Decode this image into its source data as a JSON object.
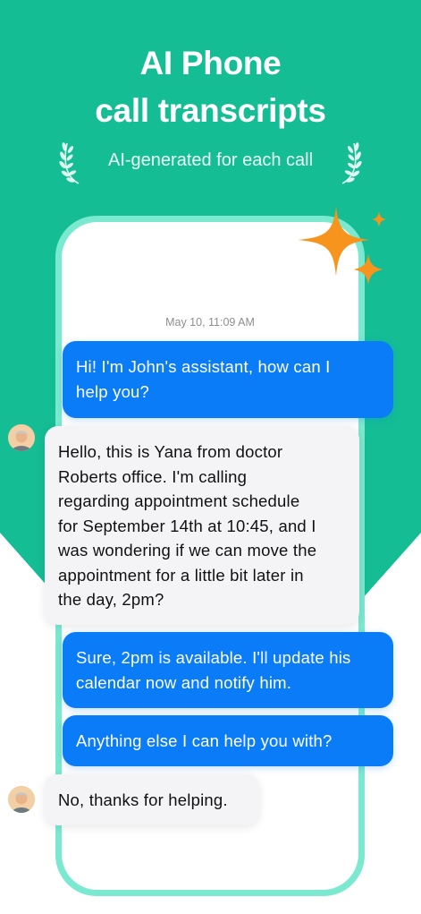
{
  "header": {
    "title_line1": "AI Phone",
    "title_line2": "call transcripts",
    "subtitle": "AI-generated for each call"
  },
  "conversation": {
    "timestamp": "May 10, 11:09 AM",
    "messages": [
      {
        "sender": "assistant",
        "lines": [
          "Hi! I'm John's assistant, how can I",
          "help you?"
        ]
      },
      {
        "sender": "caller",
        "lines": [
          "Hello, this is Yana from doctor",
          "Roberts office. I'm calling",
          "regarding appointment schedule",
          "for September 14th at 10:45, and I",
          "was wondering if we can move the",
          "appointment for a little bit later in",
          "the day, 2pm?"
        ]
      },
      {
        "sender": "assistant",
        "lines": [
          "Sure, 2pm is available. I'll update his",
          "calendar now and notify him."
        ]
      },
      {
        "sender": "assistant",
        "lines": [
          "Anything else I can help you with?"
        ]
      },
      {
        "sender": "caller",
        "lines": [
          "No, thanks for helping."
        ]
      }
    ]
  },
  "colors": {
    "brand_green": "#14bd94",
    "outgoing_bubble": "#0a7cf8",
    "incoming_bubble": "#f4f4f6",
    "sparkle": "#f7941d",
    "phone_frame": "#7ae9cf"
  },
  "icons": {
    "laurel_left": "laurel-left-icon",
    "laurel_right": "laurel-right-icon",
    "sparkles": "sparkles-icon",
    "caller_avatar": "avatar"
  }
}
